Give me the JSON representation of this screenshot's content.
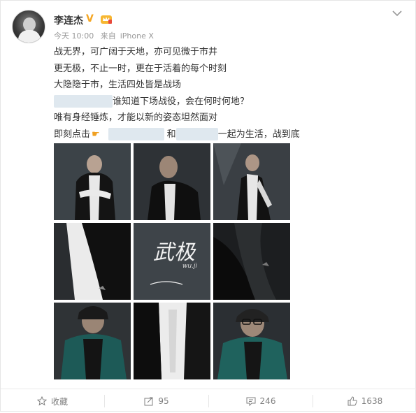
{
  "post": {
    "author": "李连杰",
    "time": "今天 10:00",
    "source_prefix": "来自",
    "source": "iPhone X",
    "lines": [
      "战无界，可广阔于天地，亦可见微于市井",
      "更无极，不止一时，更在于活着的每个时刻",
      "大隐隐于市，生活四处皆是战场",
      "谁知道下场战役，会在何时何地？",
      "唯有身经锤炼，才能以新的姿态坦然面对"
    ],
    "last_line": {
      "prefix": "即刻点击",
      "middle": "和",
      "suffix": "一起为生活，战到底"
    },
    "center_image_text": {
      "main": "武极",
      "sub": "wu.ji"
    }
  },
  "actions": {
    "favorite_label": "收藏",
    "repost_count": "95",
    "comment_count": "246",
    "like_count": "1638"
  },
  "colors": {
    "verified": "#f5a623",
    "text": "#333333",
    "meta": "#999999",
    "accent": "#f0a020"
  }
}
